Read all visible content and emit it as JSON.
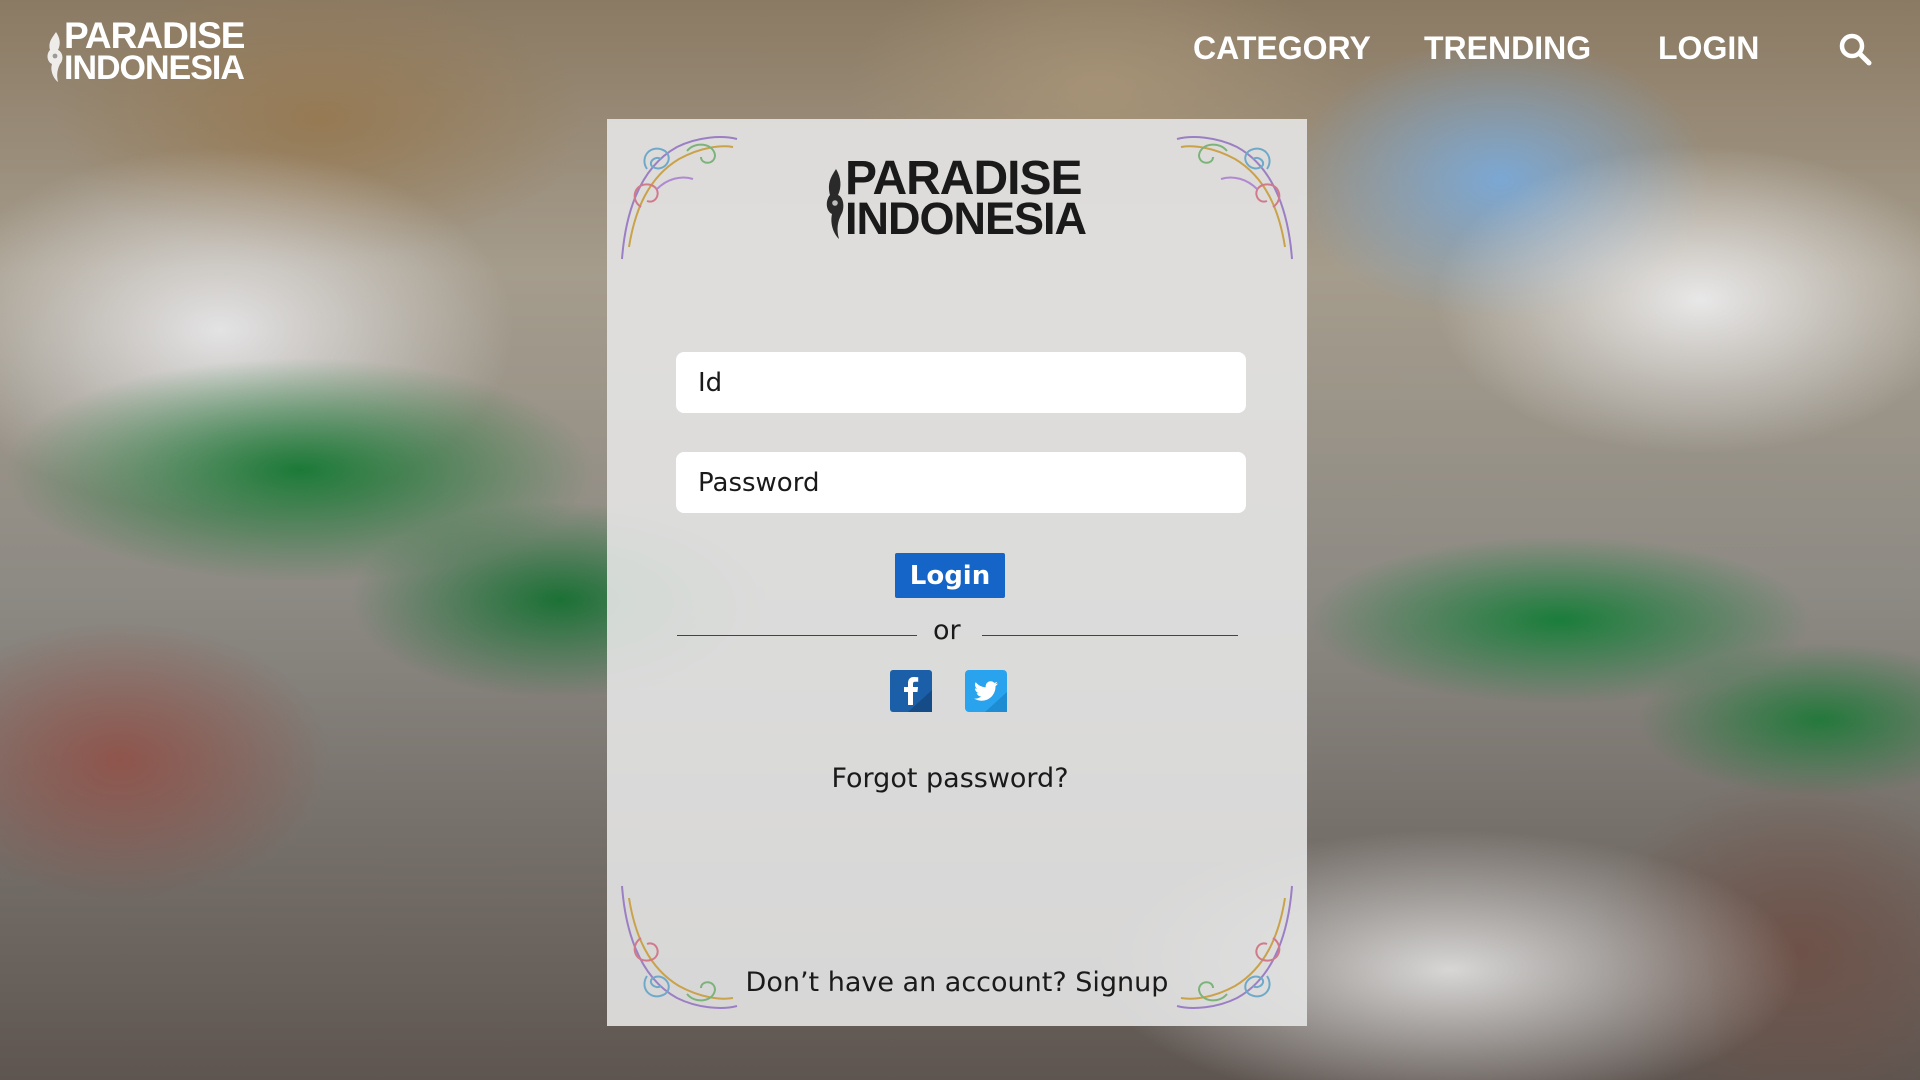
{
  "brand": {
    "line1": "PARADISE",
    "line2": "INDONESIA"
  },
  "nav": {
    "items": [
      {
        "label": "CATEGORY"
      },
      {
        "label": "TRENDING"
      },
      {
        "label": "LOGIN"
      }
    ],
    "search_icon": "search-icon"
  },
  "login_card": {
    "brand": {
      "line1": "PARADISE",
      "line2": "INDONESIA"
    },
    "id_field": {
      "placeholder": "Id",
      "value": ""
    },
    "password_field": {
      "placeholder": "Password",
      "value": ""
    },
    "login_button": "Login",
    "divider_text": "or",
    "social": [
      {
        "icon": "facebook-icon",
        "color": "#1b5fa8"
      },
      {
        "icon": "twitter-icon",
        "color": "#2aa3ef"
      }
    ],
    "forgot_password": "Forgot password?",
    "signup_prompt": "Don’t have an account?",
    "signup_link": "Signup"
  },
  "colors": {
    "login_button": "#1565c8",
    "card_background": "#e4e4e4"
  }
}
